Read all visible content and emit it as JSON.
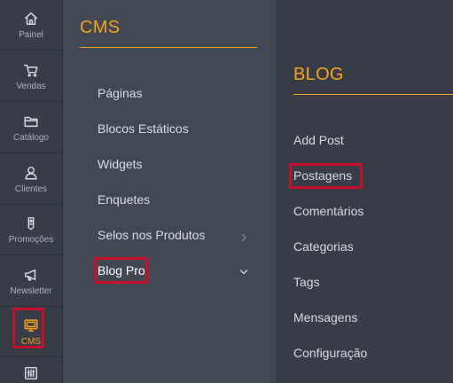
{
  "rail": {
    "items": [
      {
        "label": "Painel",
        "icon": "home-icon"
      },
      {
        "label": "Vendas",
        "icon": "cart-icon"
      },
      {
        "label": "Catálogo",
        "icon": "folder-icon"
      },
      {
        "label": "Clientes",
        "icon": "person-icon"
      },
      {
        "label": "Promoções",
        "icon": "tag-icon"
      },
      {
        "label": "Newsletter",
        "icon": "megaphone-icon"
      },
      {
        "label": "CMS",
        "icon": "monitor-icon",
        "active": true
      },
      {
        "label": "",
        "icon": "sliders-icon"
      }
    ]
  },
  "cms_panel": {
    "title": "CMS",
    "items": [
      {
        "label": "Páginas"
      },
      {
        "label": "Blocos Estáticos"
      },
      {
        "label": "Widgets"
      },
      {
        "label": "Enquetes"
      },
      {
        "label": "Selos nos Produtos",
        "chevron": "right"
      },
      {
        "label": "Blog Pro",
        "chevron": "down",
        "highlighted": true
      }
    ]
  },
  "blog_panel": {
    "title": "BLOG",
    "items": [
      {
        "label": "Add Post"
      },
      {
        "label": "Postagens",
        "highlighted": true
      },
      {
        "label": "Comentários"
      },
      {
        "label": "Categorias"
      },
      {
        "label": "Tags"
      },
      {
        "label": "Mensagens"
      },
      {
        "label": "Configuração"
      }
    ]
  },
  "colors": {
    "accent": "#f7a21b",
    "highlight": "#c8102e",
    "rail_bg": "#373c47",
    "panel_bg": "#414753"
  }
}
